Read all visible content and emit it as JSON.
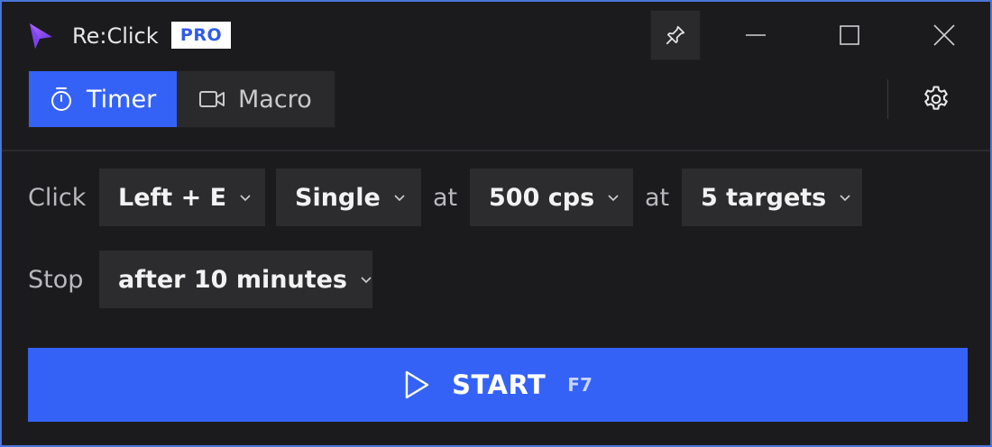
{
  "app": {
    "name": "Re:Click",
    "badge": "PRO"
  },
  "tabs": [
    {
      "label": "Timer",
      "icon": "stopwatch-icon",
      "active": true
    },
    {
      "label": "Macro",
      "icon": "video-camera-icon",
      "active": false
    }
  ],
  "click_row": {
    "label": "Click",
    "button": "Left + E",
    "type": "Single",
    "at_1": "at",
    "rate": "500 cps",
    "at_2": "at",
    "targets": "5 targets"
  },
  "stop_row": {
    "label": "Stop",
    "condition": "after 10 minutes"
  },
  "start": {
    "label": "START",
    "hotkey": "F7"
  },
  "colors": {
    "accent": "#3562f6",
    "window_bg": "#1b1b1d",
    "control_bg": "#2c2c2f",
    "badge_text": "#2f5be8",
    "window_border": "#4a74d6"
  }
}
